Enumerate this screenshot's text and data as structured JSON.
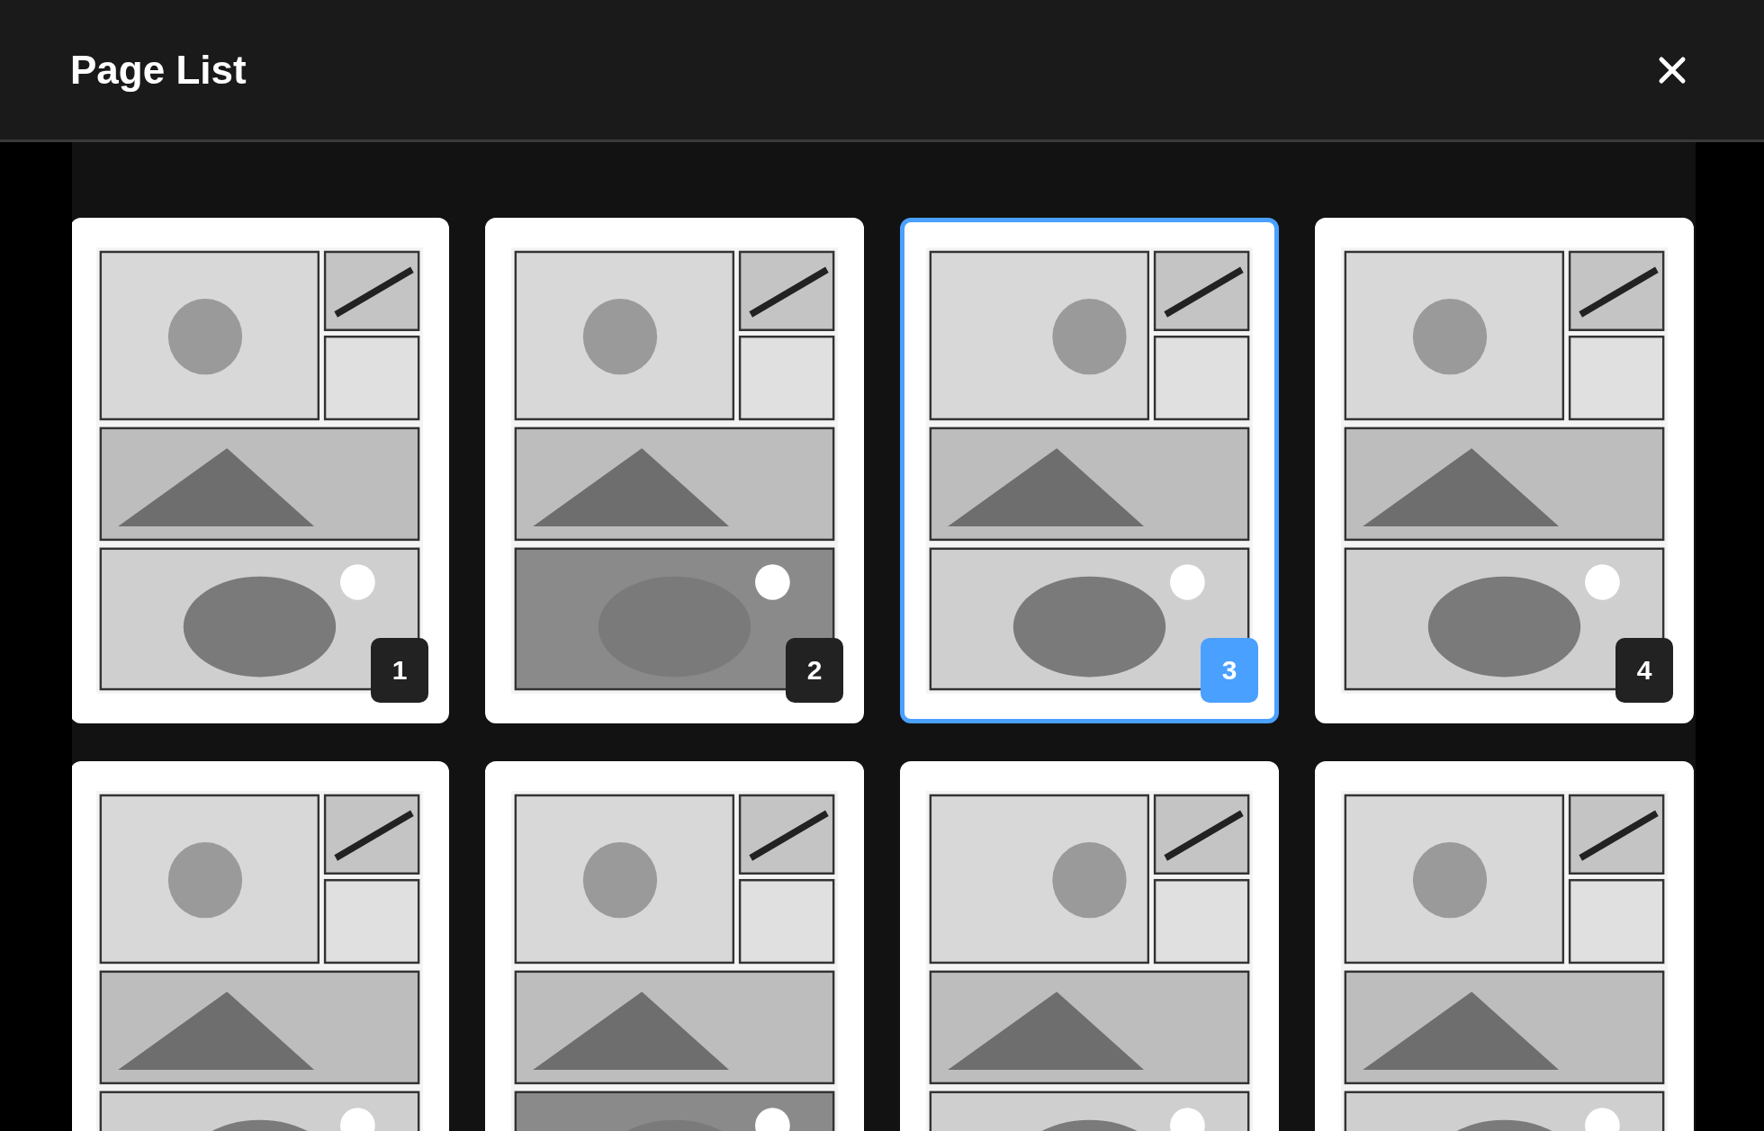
{
  "header": {
    "title": "Page List"
  },
  "pages": [
    {
      "number": "1",
      "selected": false
    },
    {
      "number": "2",
      "selected": false
    },
    {
      "number": "3",
      "selected": true
    },
    {
      "number": "4",
      "selected": false
    },
    {
      "selected": false
    },
    {
      "selected": false
    },
    {
      "selected": false
    },
    {
      "selected": false
    }
  ]
}
